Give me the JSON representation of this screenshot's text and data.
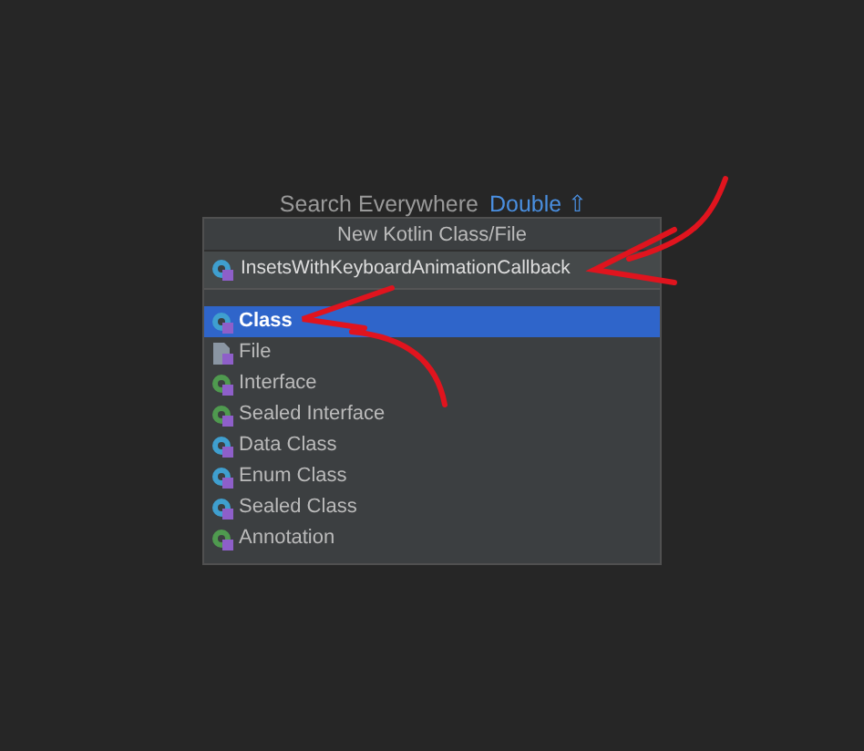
{
  "hint": {
    "text": "Search Everywhere",
    "shortcut": "Double ⇧"
  },
  "dialog": {
    "title": "New Kotlin Class/File",
    "input": {
      "value": "InsetsWithKeyboardAnimationCallback"
    },
    "items": [
      {
        "label": "Class",
        "kind": "class",
        "color": "#3f9fcf",
        "selected": true
      },
      {
        "label": "File",
        "kind": "file",
        "color": "#8a96a3",
        "selected": false
      },
      {
        "label": "Interface",
        "kind": "class",
        "color": "#4f9a4f",
        "selected": false
      },
      {
        "label": "Sealed Interface",
        "kind": "class",
        "color": "#4f9a4f",
        "selected": false
      },
      {
        "label": "Data Class",
        "kind": "class",
        "color": "#3f9fcf",
        "selected": false
      },
      {
        "label": "Enum Class",
        "kind": "class",
        "color": "#3f9fcf",
        "selected": false
      },
      {
        "label": "Sealed Class",
        "kind": "class",
        "color": "#3f9fcf",
        "selected": false
      },
      {
        "label": "Annotation",
        "kind": "class",
        "color": "#4f9a4f",
        "selected": false
      }
    ]
  }
}
